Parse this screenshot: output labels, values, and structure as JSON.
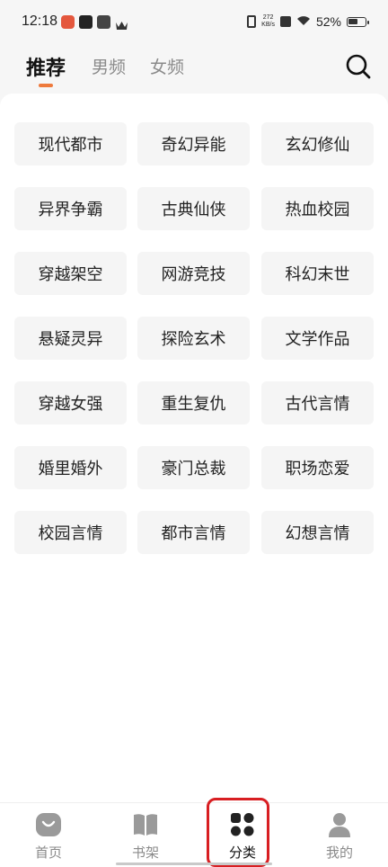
{
  "status_bar": {
    "time": "12:18",
    "net_speed_top": "272",
    "net_speed_bottom": "KB/s",
    "battery_percent": "52%"
  },
  "top_tabs": [
    {
      "label": "推荐",
      "active": true
    },
    {
      "label": "男频",
      "active": false
    },
    {
      "label": "女频",
      "active": false
    }
  ],
  "categories": [
    [
      "现代都市",
      "奇幻异能",
      "玄幻修仙"
    ],
    [
      "异界争霸",
      "古典仙侠",
      "热血校园"
    ],
    [
      "穿越架空",
      "网游竞技",
      "科幻末世"
    ],
    [
      "悬疑灵异",
      "探险玄术",
      "文学作品"
    ],
    [
      "穿越女强",
      "重生复仇",
      "古代言情"
    ],
    [
      "婚里婚外",
      "豪门总裁",
      "职场恋爱"
    ],
    [
      "校园言情",
      "都市言情",
      "幻想言情"
    ]
  ],
  "bottom_nav": [
    {
      "label": "首页",
      "icon": "home-icon",
      "active": false
    },
    {
      "label": "书架",
      "icon": "bookshelf-icon",
      "active": false
    },
    {
      "label": "分类",
      "icon": "category-icon",
      "active": true
    },
    {
      "label": "我的",
      "icon": "profile-icon",
      "active": false
    }
  ],
  "colors": {
    "accent": "#ee7a3c",
    "highlight_box": "#d81e22",
    "tab_inactive": "#8a8a8a",
    "category_bg": "#f5f5f5"
  }
}
